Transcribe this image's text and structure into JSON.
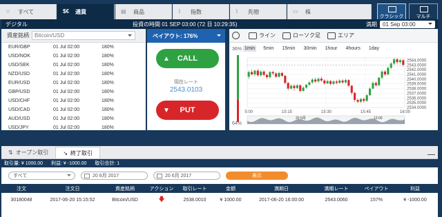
{
  "top_tabs": [
    {
      "label": "すべて",
      "icon": "star-icon"
    },
    {
      "label": "通貨",
      "icon": "currency-icon"
    },
    {
      "label": "商品",
      "icon": "commodity-icon"
    },
    {
      "label": "指数",
      "icon": "index-chart-icon"
    },
    {
      "label": "先物",
      "icon": "futures-chart-icon"
    },
    {
      "label": "株",
      "icon": "stock-folder-icon"
    }
  ],
  "view_buttons": {
    "classic": "クラシック",
    "multi": "マルチ"
  },
  "header": {
    "title": "デジタル",
    "time": "投資の時間 01 SEP 03:00 (72 日 10:29:35)",
    "expiry_label": "満期",
    "expiry_value": "01 Sep 03:00"
  },
  "asset_panel": {
    "label": "資産銘柄",
    "select_placeholder": "Bitcoin/USD",
    "rows": [
      [
        "EUR/GBP",
        "01 Jul 02:00",
        "180%"
      ],
      [
        "USD/NOK",
        "01 Jul 02:00",
        "180%"
      ],
      [
        "USD/SEK",
        "01 Jul 02:00",
        "180%"
      ],
      [
        "NZD/USD",
        "01 Jul 02:00",
        "180%"
      ],
      [
        "EUR/USD",
        "01 Jul 02:00",
        "180%"
      ],
      [
        "GBP/USD",
        "01 Jul 02:00",
        "180%"
      ],
      [
        "USD/CHF",
        "01 Jul 02:00",
        "180%"
      ],
      [
        "USD/CAD",
        "01 Jul 02:00",
        "180%"
      ],
      [
        "AUD/USD",
        "01 Jul 02:00",
        "180%"
      ],
      [
        "USD/JPY",
        "01 Jul 02:00",
        "180%"
      ]
    ]
  },
  "trade": {
    "payout": "ペイアウト:  176%",
    "call": "CALL",
    "put": "PUT",
    "rate_label": "現在レート",
    "rate_value": "2543.0103"
  },
  "chart_tools": {
    "line": "ライン",
    "candle": "ローソク足",
    "area": "エリア"
  },
  "timeframes": [
    "1min",
    "5min",
    "15min",
    "30min",
    "1hour",
    "4hours",
    "1day"
  ],
  "sentiment": {
    "up": "36%",
    "down": "64%"
  },
  "chart_data": {
    "type": "candlestick",
    "x_ticks": [
      "15:00",
      "15:15",
      "15:30",
      "15:45",
      "16:00"
    ],
    "y_ticks": [
      "2544.0000",
      "2543.0000",
      "2542.0000",
      "2541.0000",
      "2540.0000",
      "2539.0000",
      "2538.0000",
      "2537.0000",
      "2536.0000",
      "2535.0000",
      "2534.0000"
    ],
    "ylim": [
      2534,
      2544.5
    ],
    "current_price": "2543.0103",
    "overview_labels": [
      "20 6月",
      "12:00"
    ],
    "candles": [
      [
        2540.5,
        2541.5,
        2540.0,
        2541.8
      ],
      [
        2541.5,
        2541.0,
        2540.8,
        2542.0
      ],
      [
        2541.0,
        2541.8,
        2540.6,
        2542.0
      ],
      [
        2541.8,
        2540.8,
        2540.5,
        2542.2
      ],
      [
        2540.8,
        2541.6,
        2540.5,
        2541.9
      ],
      [
        2541.6,
        2540.9,
        2540.6,
        2541.9
      ],
      [
        2540.9,
        2540.4,
        2540.0,
        2541.2
      ],
      [
        2540.4,
        2541.5,
        2540.1,
        2541.7
      ],
      [
        2541.5,
        2541.2,
        2540.8,
        2541.8
      ],
      [
        2541.2,
        2540.5,
        2540.2,
        2541.5
      ],
      [
        2540.5,
        2541.3,
        2540.3,
        2541.6
      ],
      [
        2541.3,
        2540.7,
        2540.4,
        2541.6
      ],
      [
        2540.7,
        2539.2,
        2538.9,
        2540.9
      ],
      [
        2539.2,
        2538.0,
        2537.6,
        2539.4
      ],
      [
        2538.0,
        2538.6,
        2537.8,
        2538.9
      ],
      [
        2538.6,
        2538.1,
        2537.6,
        2538.9
      ],
      [
        2538.1,
        2538.7,
        2537.9,
        2539.0
      ],
      [
        2538.7,
        2537.5,
        2537.2,
        2538.9
      ],
      [
        2537.5,
        2538.2,
        2537.3,
        2538.5
      ],
      [
        2538.2,
        2538.8,
        2537.9,
        2539.0
      ],
      [
        2538.8,
        2539.3,
        2538.6,
        2539.6
      ],
      [
        2539.3,
        2539.9,
        2539.0,
        2540.2
      ],
      [
        2539.9,
        2539.5,
        2539.2,
        2540.3
      ],
      [
        2539.5,
        2540.1,
        2539.2,
        2540.4
      ],
      [
        2540.1,
        2539.7,
        2539.4,
        2540.5
      ],
      [
        2539.7,
        2539.1,
        2538.8,
        2540.0
      ],
      [
        2539.1,
        2539.6,
        2538.9,
        2539.9
      ],
      [
        2539.6,
        2539.0,
        2538.7,
        2539.8
      ],
      [
        2539.0,
        2539.5,
        2538.7,
        2539.8
      ],
      [
        2539.5,
        2539.2,
        2538.9,
        2539.8
      ],
      [
        2539.2,
        2539.7,
        2539.0,
        2540.0
      ],
      [
        2539.7,
        2539.3,
        2539.0,
        2540.0
      ],
      [
        2539.3,
        2539.8,
        2539.0,
        2540.1
      ],
      [
        2539.8,
        2538.6,
        2538.3,
        2540.0
      ],
      [
        2538.6,
        2537.1,
        2536.6,
        2538.8
      ],
      [
        2537.1,
        2535.6,
        2535.2,
        2537.3
      ],
      [
        2535.6,
        2535.2,
        2534.9,
        2535.9
      ],
      [
        2535.2,
        2535.8,
        2534.9,
        2536.0
      ],
      [
        2535.8,
        2535.4,
        2535.0,
        2536.1
      ],
      [
        2535.4,
        2536.6,
        2535.2,
        2536.8
      ],
      [
        2536.6,
        2538.0,
        2536.4,
        2538.3
      ],
      [
        2538.0,
        2539.2,
        2537.8,
        2539.5
      ],
      [
        2539.2,
        2538.7,
        2538.4,
        2539.5
      ],
      [
        2538.7,
        2540.3,
        2538.5,
        2540.5
      ],
      [
        2540.3,
        2541.6,
        2540.0,
        2541.9
      ],
      [
        2541.6,
        2541.0,
        2540.7,
        2541.9
      ],
      [
        2541.0,
        2542.4,
        2540.8,
        2542.7
      ],
      [
        2542.4,
        2543.3,
        2542.1,
        2543.6
      ],
      [
        2543.3,
        2544.2,
        2543.0,
        2544.5
      ],
      [
        2544.2,
        2543.6,
        2543.2,
        2544.5
      ],
      [
        2543.6,
        2544.0,
        2543.2,
        2544.3
      ],
      [
        2544.0,
        2543.0,
        2542.7,
        2544.2
      ]
    ]
  },
  "bottom": {
    "tabs": [
      "オープン取引",
      "終了取引"
    ],
    "summary": {
      "amount": "取引量: ¥ 1000.00",
      "profit": "利益: ¥ -1000.00",
      "total": "取引合計: 1"
    },
    "filter": {
      "select": "すべて",
      "date_from": "20 6月 2017",
      "date_to": "20 6月 2017",
      "show": "表示"
    },
    "headers": [
      "注文",
      "注文日",
      "資産銘柄",
      "アクション",
      "取引レート",
      "金額",
      "満期日",
      "満期レート",
      "ペイアウト",
      "利益"
    ],
    "rows": [
      {
        "order": "30180048",
        "date": "2017-06-20 15:15:52",
        "asset": "Bitcoin/USD",
        "action": "down",
        "rate": "2538.0010",
        "amount": "¥ 1000.00",
        "expiry": "2017-06-20 16:00:00",
        "expiry_rate": "2543.0060",
        "payout": "157%",
        "profit": "¥ -1000.00"
      }
    ]
  },
  "colors": {
    "navy": "#17385a",
    "blue": "#1f63b0",
    "green": "#2ea141",
    "red": "#d8252a",
    "orange": "#f28d2d"
  }
}
